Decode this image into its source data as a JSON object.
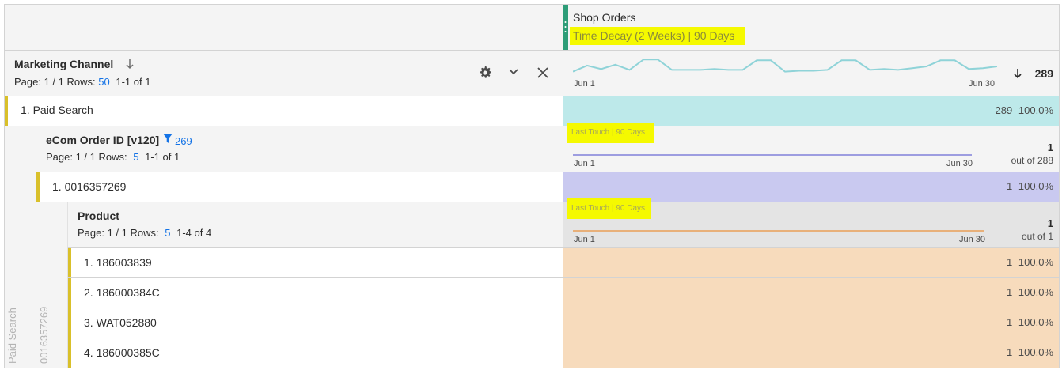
{
  "metric_header": {
    "title": "Shop Orders",
    "attribution": "Time Decay (2 Weeks) | 90 Days"
  },
  "level1": {
    "dimension": "Marketing Channel",
    "page_label": "Page: 1 / 1",
    "rows_label": "Rows:",
    "rows_value": "50",
    "range": "1-1 of 1",
    "sparkline_start": "Jun 1",
    "sparkline_end": "Jun 30",
    "total": "289",
    "sparkline_color": "#8fd3d8",
    "sparkline_values": [
      0.2,
      0.55,
      0.35,
      0.6,
      0.3,
      0.9,
      0.9,
      0.3,
      0.3,
      0.3,
      0.35,
      0.3,
      0.3,
      0.85,
      0.85,
      0.2,
      0.25,
      0.25,
      0.3,
      0.85,
      0.85,
      0.3,
      0.35,
      0.3,
      0.4,
      0.5,
      0.85,
      0.85,
      0.35,
      0.4,
      0.5
    ],
    "row": {
      "label": "1. Paid Search",
      "value": "289",
      "pct": "100.0%",
      "fill_color": "#bde9ea"
    }
  },
  "level2": {
    "dimension": "eCom Order ID [v120]",
    "filter_count": "269",
    "page_label": "Page: 1 / 1",
    "rows_label": "Rows:",
    "rows_value": "5",
    "range": "1-1 of 1",
    "attribution": "Last Touch | 90 Days",
    "sparkline_start": "Jun 1",
    "sparkline_end": "Jun 30",
    "total": "1",
    "total_of": "out of 288",
    "sparkline_color": "#9d9de0",
    "side_label": "Paid Search",
    "row": {
      "label": "1. 0016357269",
      "value": "1",
      "pct": "100.0%",
      "fill_color": "#c9c9f0"
    }
  },
  "level3": {
    "dimension": "Product",
    "page_label": "Page: 1 / 1",
    "rows_label": "Rows:",
    "rows_value": "5",
    "range": "1-4 of 4",
    "attribution": "Last Touch | 90 Days",
    "sparkline_start": "Jun 1",
    "sparkline_end": "Jun 30",
    "total": "1",
    "total_of": "out of 1",
    "sparkline_color": "#e8b07a",
    "side_label": "0016357269",
    "fill_color": "#f7dbbc",
    "rows": [
      {
        "label": "1. 186003839",
        "value": "1",
        "pct": "100.0%"
      },
      {
        "label": "2. 186000384C",
        "value": "1",
        "pct": "100.0%"
      },
      {
        "label": "3. WAT052880",
        "value": "1",
        "pct": "100.0%"
      },
      {
        "label": "4. 186000385C",
        "value": "1",
        "pct": "100.0%"
      }
    ]
  }
}
